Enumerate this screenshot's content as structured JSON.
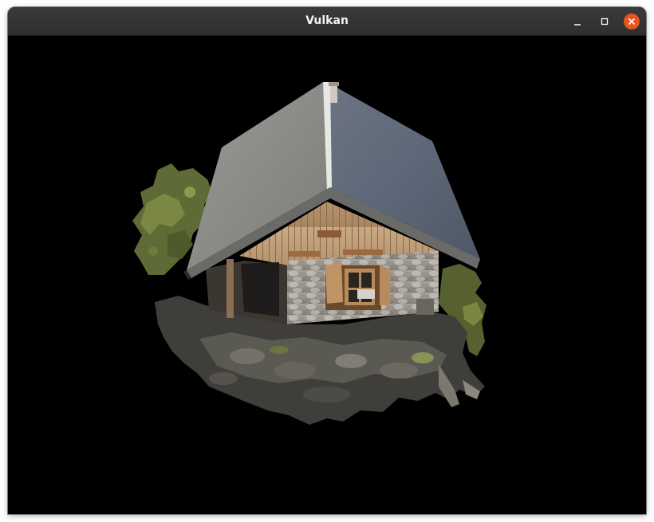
{
  "window": {
    "title": "Vulkan",
    "controls": {
      "minimize_icon": "minimize-icon",
      "maximize_icon": "maximize-icon",
      "close_icon": "close-icon",
      "close_color": "#e95420"
    }
  },
  "viewport": {
    "background": "#000000",
    "content": "3d-model-stone-cabin"
  }
}
